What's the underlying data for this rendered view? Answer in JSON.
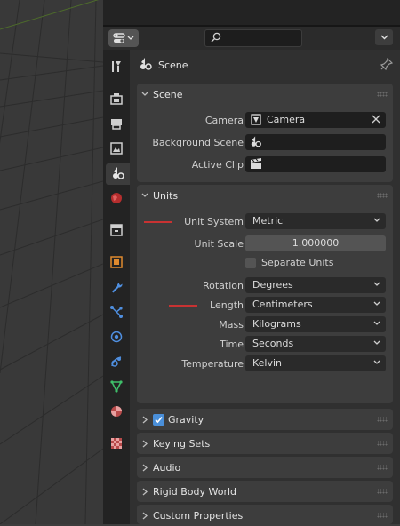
{
  "properties": {
    "context_title": "Scene",
    "tabs": [
      {
        "name": "tool",
        "icon": "tool-icon"
      },
      {
        "name": "render",
        "icon": "render-icon"
      },
      {
        "name": "output",
        "icon": "output-icon"
      },
      {
        "name": "view-layer",
        "icon": "view-layer-icon"
      },
      {
        "name": "scene",
        "icon": "scene-icon",
        "active": true
      },
      {
        "name": "world",
        "icon": "world-icon"
      },
      {
        "name": "collection",
        "icon": "collection-icon"
      },
      {
        "name": "object",
        "icon": "object-icon"
      },
      {
        "name": "modifiers",
        "icon": "wrench-icon"
      },
      {
        "name": "particles",
        "icon": "particles-icon"
      },
      {
        "name": "physics",
        "icon": "physics-icon"
      },
      {
        "name": "constraints",
        "icon": "constraints-icon"
      },
      {
        "name": "data",
        "icon": "mesh-data-icon"
      },
      {
        "name": "material",
        "icon": "material-icon"
      },
      {
        "name": "texture",
        "icon": "texture-icon"
      }
    ],
    "scene_panel": {
      "title": "Scene",
      "camera_label": "Camera",
      "camera_value": "Camera",
      "background_scene_label": "Background Scene",
      "active_clip_label": "Active Clip"
    },
    "units_panel": {
      "title": "Units",
      "unit_system_label": "Unit System",
      "unit_system_value": "Metric",
      "unit_scale_label": "Unit Scale",
      "unit_scale_value": "1.000000",
      "separate_units_label": "Separate Units",
      "separate_units_checked": false,
      "rotation_label": "Rotation",
      "rotation_value": "Degrees",
      "length_label": "Length",
      "length_value": "Centimeters",
      "mass_label": "Mass",
      "mass_value": "Kilograms",
      "time_label": "Time",
      "time_value": "Seconds",
      "temperature_label": "Temperature",
      "temperature_value": "Kelvin"
    },
    "collapsed_panels": {
      "gravity": "Gravity",
      "gravity_checked": true,
      "keying_sets": "Keying Sets",
      "audio": "Audio",
      "rigid_body_world": "Rigid Body World",
      "custom_properties": "Custom Properties"
    }
  },
  "colors": {
    "annotation": "#c83232",
    "accent": "#4a8fd9",
    "active_tab_icon": "#e8e8e8"
  }
}
